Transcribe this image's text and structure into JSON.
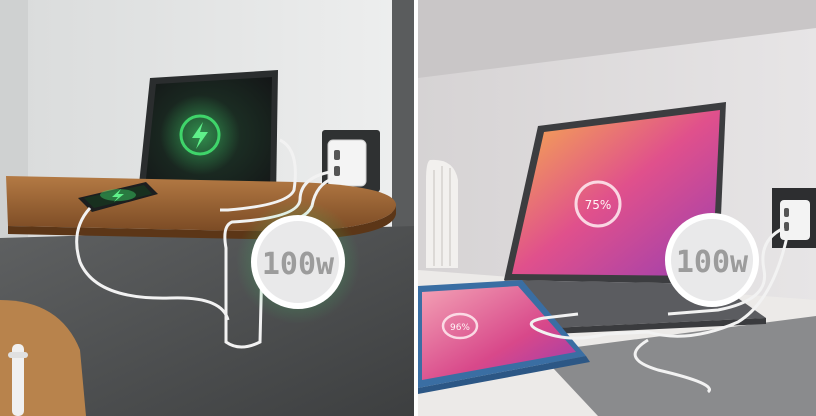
{
  "left_scene": {
    "power_badge": "100w",
    "tablet_screen_icon": "lightning-bolt-icon",
    "phone_screen_icon": "lightning-bolt-icon",
    "accent_glow": "#3fd46a"
  },
  "right_scene": {
    "power_badge": "100w",
    "laptop_battery_text": "75%",
    "tablet_battery_text": "96%",
    "accent_gradient": [
      "#f7b24a",
      "#e0508c",
      "#9a3fb0"
    ]
  }
}
